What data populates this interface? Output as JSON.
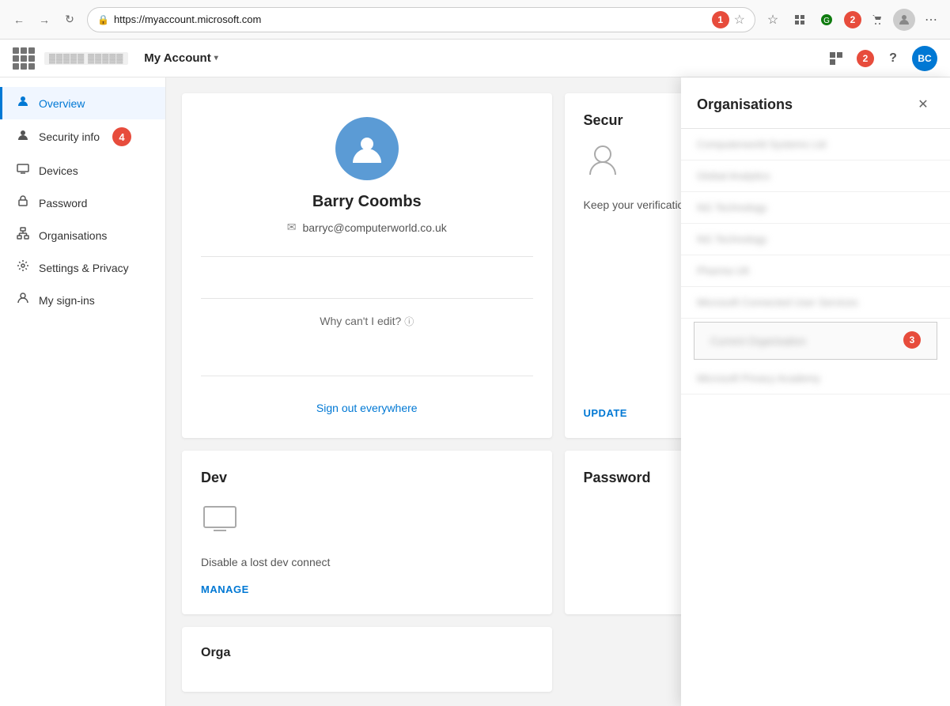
{
  "browser": {
    "back_btn": "←",
    "forward_btn": "→",
    "refresh_btn": "↻",
    "url": "https://myaccount.microsoft.com",
    "star_icon": "☆",
    "badge1_label": "1",
    "badge2_label": "2",
    "more_icon": "⋯",
    "profile_initials": ""
  },
  "appbar": {
    "title": "My Account",
    "chevron": "▾",
    "logo_placeholder": "▓▓▓▓▓▓▓ ▓▓▓▓▓▓▓",
    "badge2_label": "2",
    "help_icon": "?",
    "network_icon": "⊞",
    "avatar_label": "BC"
  },
  "sidebar": {
    "items": [
      {
        "id": "overview",
        "label": "Overview",
        "icon": "👤",
        "active": true
      },
      {
        "id": "security-info",
        "label": "Security info",
        "icon": "🔒",
        "active": false
      },
      {
        "id": "devices",
        "label": "Devices",
        "icon": "🖥",
        "active": false
      },
      {
        "id": "password",
        "label": "Password",
        "icon": "🔑",
        "active": false
      },
      {
        "id": "organisations",
        "label": "Organisations",
        "icon": "🏢",
        "active": false
      },
      {
        "id": "settings-privacy",
        "label": "Settings & Privacy",
        "icon": "⚙",
        "active": false
      },
      {
        "id": "my-sign-ins",
        "label": "My sign-ins",
        "icon": "📋",
        "active": false
      }
    ]
  },
  "profile_card": {
    "avatar_icon": "👤",
    "name": "Barry Coombs",
    "email": "barryc@computerworld.co.uk",
    "edit_text": "Why can't I edit?",
    "sign_out_link": "Sign out everywhere"
  },
  "security_card": {
    "title": "Secur",
    "desc": "Keep your verification info up",
    "action": "UPDATE"
  },
  "devices_card": {
    "title": "Dev",
    "desc": "Disable a lost dev connect",
    "action": "MANAGE"
  },
  "password_card": {
    "title": "Password"
  },
  "orgs_card": {
    "title": "Orga"
  },
  "orgs_panel": {
    "title": "Organisations",
    "close_icon": "✕",
    "items": [
      {
        "id": "org1",
        "label": "██████████████████",
        "highlighted": false
      },
      {
        "id": "org2",
        "label": "██████████████",
        "highlighted": false
      },
      {
        "id": "org3",
        "label": "████ ████████",
        "highlighted": false
      },
      {
        "id": "org4",
        "label": "████ ████████",
        "highlighted": false
      },
      {
        "id": "org5",
        "label": "██████ ██",
        "highlighted": false
      },
      {
        "id": "org6",
        "label": "███████ ██████████ ████████",
        "highlighted": false
      },
      {
        "id": "org7",
        "label": "███████████████████",
        "highlighted": true
      },
      {
        "id": "org8",
        "label": "████████ ██████ ████████",
        "highlighted": false
      }
    ]
  },
  "badges": {
    "badge1": "1",
    "badge2": "2",
    "badge3": "3",
    "badge4": "4"
  }
}
